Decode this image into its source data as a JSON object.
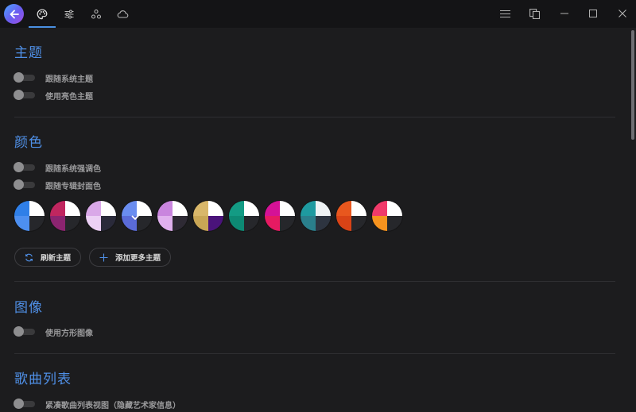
{
  "titlebar": {
    "tabs": [
      {
        "name": "palette",
        "icon": "palette-icon",
        "active": true
      },
      {
        "name": "sliders",
        "icon": "sliders-icon",
        "active": false
      },
      {
        "name": "nodes",
        "icon": "nodes-icon",
        "active": false
      },
      {
        "name": "cloud",
        "icon": "cloud-icon",
        "active": false
      }
    ],
    "window_controls": [
      "menu-icon",
      "mini-player-icon",
      "minimize-icon",
      "maximize-icon",
      "close-icon"
    ]
  },
  "sections": {
    "theme": {
      "title": "主题",
      "toggles": [
        {
          "label": "跟随系统主题",
          "on": false
        },
        {
          "label": "使用亮色主题",
          "on": false
        }
      ]
    },
    "color": {
      "title": "颜色",
      "toggles": [
        {
          "label": "跟随系统强调色",
          "on": false
        },
        {
          "label": "跟随专辑封面色",
          "on": false
        }
      ],
      "selected_swatch": 3,
      "buttons": {
        "refresh": "刷新主题",
        "add_more": "添加更多主题"
      }
    },
    "image": {
      "title": "图像",
      "toggles": [
        {
          "label": "使用方形图像",
          "on": false
        }
      ]
    },
    "song_list": {
      "title": "歌曲列表",
      "toggles": [
        {
          "label": "紧凑歌曲列表视图（隐藏艺术家信息）",
          "on": false
        }
      ]
    }
  },
  "swatches": [
    {
      "name": "blue",
      "tl": "#2f7fe8",
      "tr": "#ffffff",
      "bl": "#4d8ff0",
      "br": "#26272b"
    },
    {
      "name": "crimson",
      "tl": "#c0265f",
      "tr": "#ffffff",
      "bl": "#8c2470",
      "br": "#26272b"
    },
    {
      "name": "lavender",
      "tl": "#d9a8e8",
      "tr": "#ffffff",
      "bl": "#ecd0f5",
      "br": "#2a2a3a"
    },
    {
      "name": "periwinkle",
      "tl": "#6a8df0",
      "tr": "#ffffff",
      "bl": "#5a6bd8",
      "br": "#26272b"
    },
    {
      "name": "orchid",
      "tl": "#c985de",
      "tr": "#ffffff",
      "bl": "#e0b0ee",
      "br": "#2e2a34"
    },
    {
      "name": "gold",
      "tl": "#d9b76a",
      "tr": "#ffffff",
      "bl": "#c9a655",
      "br": "#4a137a"
    },
    {
      "name": "teal",
      "tl": "#139b84",
      "tr": "#ffffff",
      "bl": "#0d8a74",
      "br": "#26272b"
    },
    {
      "name": "magenta",
      "tl": "#d41296",
      "tr": "#ffffff",
      "bl": "#e61a62",
      "br": "#26272b"
    },
    {
      "name": "slate-teal",
      "tl": "#1e9aa0",
      "tr": "#eef2f4",
      "bl": "#2a7f8c",
      "br": "#2d3440"
    },
    {
      "name": "orange",
      "tl": "#e8571e",
      "tr": "#ffffff",
      "bl": "#d94316",
      "br": "#26272b"
    },
    {
      "name": "sunset",
      "tl": "#f03a6a",
      "tr": "#ffffff",
      "bl": "#f7931e",
      "br": "#26272b"
    }
  ],
  "colors": {
    "accent": "#4f8fe6",
    "background": "#1c1c1e",
    "titlebar": "#141416"
  }
}
